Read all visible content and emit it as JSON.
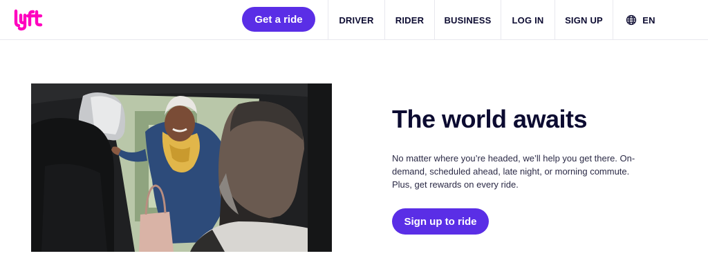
{
  "header": {
    "logo_text": "lyft",
    "get_a_ride": "Get a ride",
    "nav": {
      "driver": "DRIVER",
      "rider": "RIDER",
      "business": "BUSINESS",
      "login": "LOG IN",
      "signup": "SIGN UP",
      "language": "EN"
    },
    "icons": {
      "logo": "lyft-logo-icon",
      "language": "globe-icon"
    }
  },
  "hero": {
    "title": "The world awaits",
    "body": "No matter where you’re headed, we’ll help you get there. On-demand, scheduled ahead, late night, or morning commute. Plus, get rewards on every ride.",
    "cta": "Sign up to ride"
  },
  "colors": {
    "brand_pink": "#ff00bf",
    "brand_purple": "#5a2ee6",
    "text_dark": "#0c0b31"
  }
}
